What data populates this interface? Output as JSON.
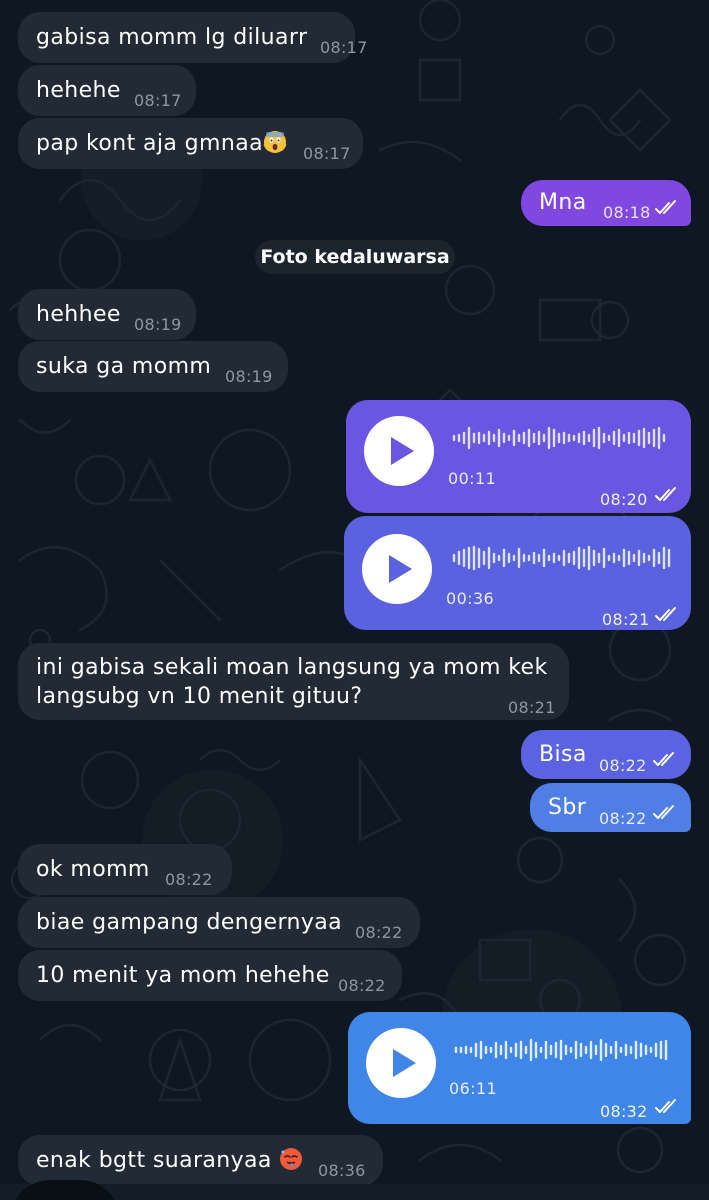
{
  "messages": [
    {
      "id": "m1",
      "dir": "in",
      "text": "gabisa momm lg diluarr",
      "time": "08:17"
    },
    {
      "id": "m2",
      "dir": "in",
      "text": "hehehe",
      "time": "08:17"
    },
    {
      "id": "m3",
      "dir": "in",
      "text": "pap kont aja gmnaa",
      "emoji": "scream-emoji",
      "time": "08:17"
    },
    {
      "id": "m4",
      "dir": "out",
      "text": "Mna",
      "time": "08:18",
      "status": "read"
    },
    {
      "id": "m6",
      "dir": "in",
      "text": "hehhee",
      "time": "08:19"
    },
    {
      "id": "m7",
      "dir": "in",
      "text": "suka ga momm",
      "time": "08:19"
    },
    {
      "id": "m10",
      "dir": "in",
      "text_line1": "ini gabisa sekali moan langsung ya mom kek",
      "text_line2": "langsubg vn 10 menit gituu?",
      "time": "08:21"
    },
    {
      "id": "m11",
      "dir": "out",
      "text": "Bisa",
      "time": "08:22",
      "status": "read"
    },
    {
      "id": "m12",
      "dir": "out",
      "text": "Sbr",
      "time": "08:22",
      "status": "read"
    },
    {
      "id": "m13",
      "dir": "in",
      "text": "ok momm",
      "time": "08:22"
    },
    {
      "id": "m14",
      "dir": "in",
      "text": "biae gampang dengernyaa",
      "time": "08:22"
    },
    {
      "id": "m15",
      "dir": "in",
      "text": "10 menit ya mom hehehe",
      "time": "08:22"
    },
    {
      "id": "m17",
      "dir": "in",
      "text": "enak bgtt suaranyaa",
      "emoji": "hot-face-emoji",
      "time": "08:36"
    }
  ],
  "service": {
    "text": "Foto kedaluwarsa"
  },
  "voice": [
    {
      "id": "v1",
      "duration": "00:11",
      "time": "08:20",
      "status": "read",
      "color": "#6b55e3"
    },
    {
      "id": "v2",
      "duration": "00:36",
      "time": "08:21",
      "status": "read",
      "color": "#5a62e0"
    },
    {
      "id": "v3",
      "duration": "06:11",
      "time": "08:32",
      "status": "read",
      "color": "#3f86e8"
    }
  ],
  "colors": {
    "background": "#0f1822",
    "incoming_bubble": "#222b35",
    "outgoing_violet": "#8048e0",
    "outgoing_indigo": "#5c63e2",
    "outgoing_blue": "#4a8ae6"
  }
}
